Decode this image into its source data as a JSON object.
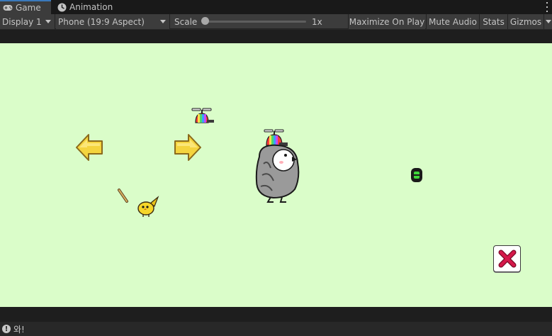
{
  "tabs": [
    {
      "label": "Game",
      "icon": "gamepad-icon",
      "active": true
    },
    {
      "label": "Animation",
      "icon": "clock-icon",
      "active": false
    }
  ],
  "toolbar": {
    "display": "Display 1",
    "aspect": "Phone (19:9 Aspect)",
    "scale_label": "Scale",
    "scale_value": "1x",
    "scale_level": 0,
    "maximize_on_play": "Maximize On Play",
    "mute_audio": "Mute Audio",
    "stats": "Stats",
    "gizmos": "Gizmos"
  },
  "status": {
    "message": "와!"
  },
  "colors": {
    "game_background": "#dafdc9",
    "arrow_yellow": "#f4d43e",
    "close_red": "#d5184a",
    "tab_accent": "#3a79bb"
  }
}
